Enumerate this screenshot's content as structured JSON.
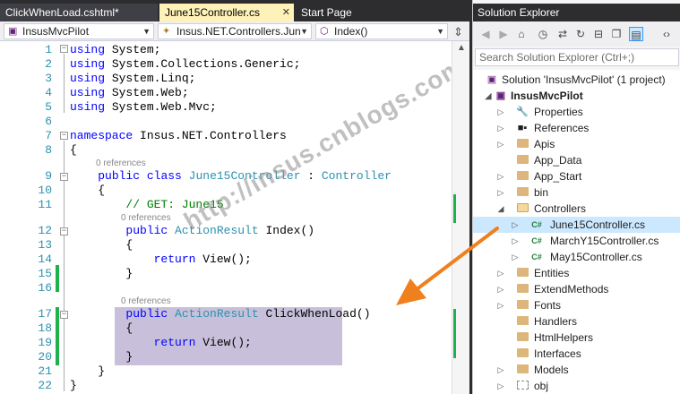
{
  "tabs": [
    {
      "label": "ClickWhenLoad.cshtml*",
      "active": false
    },
    {
      "label": "June15Controller.cs",
      "active": true
    },
    {
      "label": "Start Page",
      "active": false
    }
  ],
  "navbar": {
    "project": "InsusMvcPilot",
    "namespace": "Insus.NET.Controllers.Jun",
    "member": "Index()"
  },
  "code_lines": [
    {
      "num": "1",
      "text": "using System;"
    },
    {
      "num": "2",
      "text": "using System.Collections.Generic;"
    },
    {
      "num": "3",
      "text": "using System.Linq;"
    },
    {
      "num": "4",
      "text": "using System.Web;"
    },
    {
      "num": "5",
      "text": "using System.Web.Mvc;"
    },
    {
      "num": "6",
      "text": ""
    },
    {
      "num": "7",
      "text": "namespace Insus.NET.Controllers"
    },
    {
      "num": "8",
      "text": "{"
    },
    {
      "num": "9",
      "text": "    public class June15Controller : Controller"
    },
    {
      "num": "10",
      "text": "    {"
    },
    {
      "num": "11",
      "text": "        // GET: June15"
    },
    {
      "num": "12",
      "text": "        public ActionResult Index()"
    },
    {
      "num": "13",
      "text": "        {"
    },
    {
      "num": "14",
      "text": "            return View();"
    },
    {
      "num": "15",
      "text": "        }"
    },
    {
      "num": "16",
      "text": ""
    },
    {
      "num": "17",
      "text": "        public ActionResult ClickWhenLoad()"
    },
    {
      "num": "18",
      "text": "        {"
    },
    {
      "num": "19",
      "text": "            return View();"
    },
    {
      "num": "20",
      "text": "        }"
    },
    {
      "num": "21",
      "text": "    }"
    },
    {
      "num": "22",
      "text": "}"
    }
  ],
  "references_label": "0 references",
  "watermark": "http://insus.cnblogs.com",
  "solution_explorer": {
    "title": "Solution Explorer",
    "search_placeholder": "Search Solution Explorer (Ctrl+;)",
    "items": [
      {
        "label": "Solution 'InsusMvcPilot' (1 project)",
        "icon": "solution-icon"
      },
      {
        "label": "InsusMvcPilot",
        "icon": "project-icon"
      },
      {
        "label": "Properties",
        "icon": "wrench-icon"
      },
      {
        "label": "References",
        "icon": "references-icon"
      },
      {
        "label": "Apis",
        "icon": "folder-icon"
      },
      {
        "label": "App_Data",
        "icon": "folder-icon"
      },
      {
        "label": "App_Start",
        "icon": "folder-icon"
      },
      {
        "label": "bin",
        "icon": "folder-icon"
      },
      {
        "label": "Controllers",
        "icon": "folder-open-icon"
      },
      {
        "label": "June15Controller.cs",
        "icon": "csharp-file-icon"
      },
      {
        "label": "MarchY15Controller.cs",
        "icon": "csharp-file-icon"
      },
      {
        "label": "May15Controller.cs",
        "icon": "csharp-file-icon"
      },
      {
        "label": "Entities",
        "icon": "folder-icon"
      },
      {
        "label": "ExtendMethods",
        "icon": "folder-icon"
      },
      {
        "label": "Fonts",
        "icon": "folder-icon"
      },
      {
        "label": "Handlers",
        "icon": "folder-icon"
      },
      {
        "label": "HtmlHelpers",
        "icon": "folder-icon"
      },
      {
        "label": "Interfaces",
        "icon": "folder-icon"
      },
      {
        "label": "Models",
        "icon": "folder-icon"
      },
      {
        "label": "obj",
        "icon": "dotted-folder-icon"
      }
    ]
  },
  "colors": {
    "keyword": "#0000ff",
    "type": "#2b91af",
    "comment": "#008000",
    "highlight": "#c8c0da",
    "change_bar": "#1fb14c",
    "arrow": "#f07f1e"
  }
}
